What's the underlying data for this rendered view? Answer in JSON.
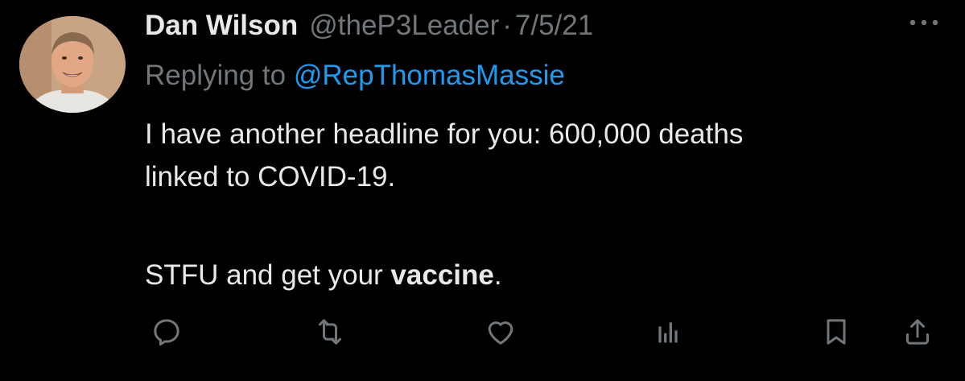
{
  "tweet": {
    "author_name": "Dan Wilson",
    "author_handle": "@theP3Leader",
    "separator": "·",
    "date": "7/5/21",
    "replying_prefix": "Replying to ",
    "replying_to": "@RepThomasMassie",
    "text_line1": "I have another headline for you:  600,000 deaths",
    "text_line2": "linked to COVID-19.",
    "text_line3_start": "STFU and get your ",
    "text_line3_bold": "vaccine",
    "text_line3_end": "."
  },
  "actions": [
    {
      "name": "reply",
      "icon": "reply-icon"
    },
    {
      "name": "retweet",
      "icon": "retweet-icon"
    },
    {
      "name": "like",
      "icon": "heart-icon"
    },
    {
      "name": "views",
      "icon": "analytics-icon"
    },
    {
      "name": "bookmark",
      "icon": "bookmark-icon"
    },
    {
      "name": "share",
      "icon": "share-icon"
    }
  ],
  "colors": {
    "background": "#000000",
    "text": "#e7e9ea",
    "secondary": "#71767b",
    "link": "#1d9bf0"
  }
}
